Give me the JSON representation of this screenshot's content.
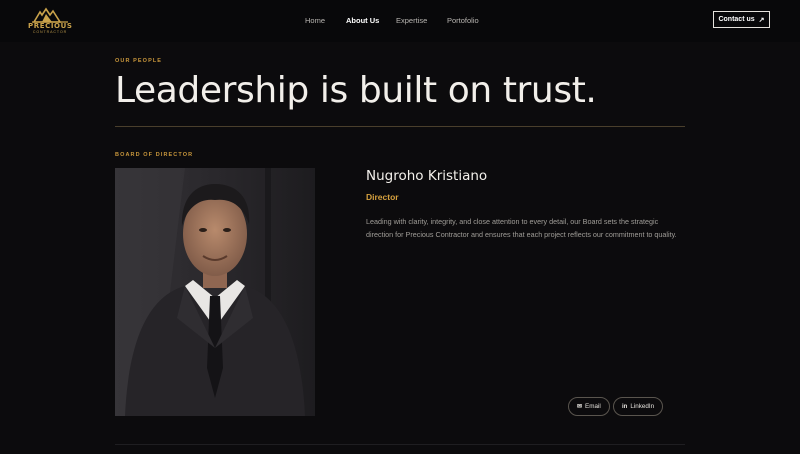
{
  "brand": {
    "name": "PRECIOUS",
    "tagline": "CONTRACTOR"
  },
  "nav": {
    "links": [
      {
        "label": "Home",
        "active": false
      },
      {
        "label": "About Us",
        "active": true
      },
      {
        "label": "Expertise",
        "active": false
      },
      {
        "label": "Portofolio",
        "active": false
      }
    ],
    "contact_label": "Contact us",
    "contact_icon": "arrow-up-right-icon"
  },
  "hero": {
    "eyebrow": "OUR PEOPLE",
    "headline": "Leadership is built on trust."
  },
  "board": {
    "eyebrow": "BOARD OF DIRECTOR",
    "member": {
      "name": "Nugroho Kristiano",
      "role": "Director",
      "bio": "Leading with clarity, integrity, and close attention to every detail, our Board sets the strategic direction for Precious Contractor and ensures that each project reflects our commitment to quality.",
      "email_label": "Email",
      "linkedin_label": "LinkedIn",
      "email_icon": "mail-icon",
      "linkedin_icon": "linkedin-icon"
    }
  },
  "colors": {
    "accent": "#c9973c",
    "background": "#0c0b0d",
    "text": "#f2efea"
  }
}
